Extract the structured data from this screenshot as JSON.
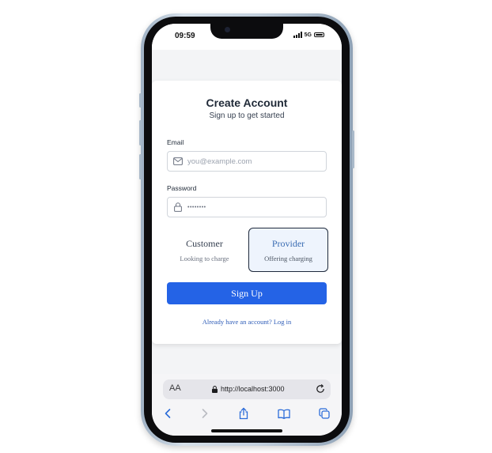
{
  "status_bar": {
    "time": "09:59",
    "network": "5G"
  },
  "auth_card": {
    "title": "Create Account",
    "subtitle": "Sign up to get started",
    "email": {
      "label": "Email",
      "placeholder": "you@example.com"
    },
    "password": {
      "label": "Password",
      "placeholder": "••••••••"
    },
    "roles": [
      {
        "title": "Customer",
        "description": "Looking to charge",
        "selected": false
      },
      {
        "title": "Provider",
        "description": "Offering charging",
        "selected": true
      }
    ],
    "signup_label": "Sign Up",
    "login_link": "Already have an account? Log in"
  },
  "browser": {
    "text_size_label": "AA",
    "url": "http://localhost:3000",
    "toolbar_icons": [
      "back-icon",
      "forward-icon",
      "share-icon",
      "bookmarks-icon",
      "tabs-icon"
    ]
  },
  "colors": {
    "accent": "#2463e6",
    "selected_role_bg": "#eef4fd",
    "link": "#2f5db8"
  }
}
